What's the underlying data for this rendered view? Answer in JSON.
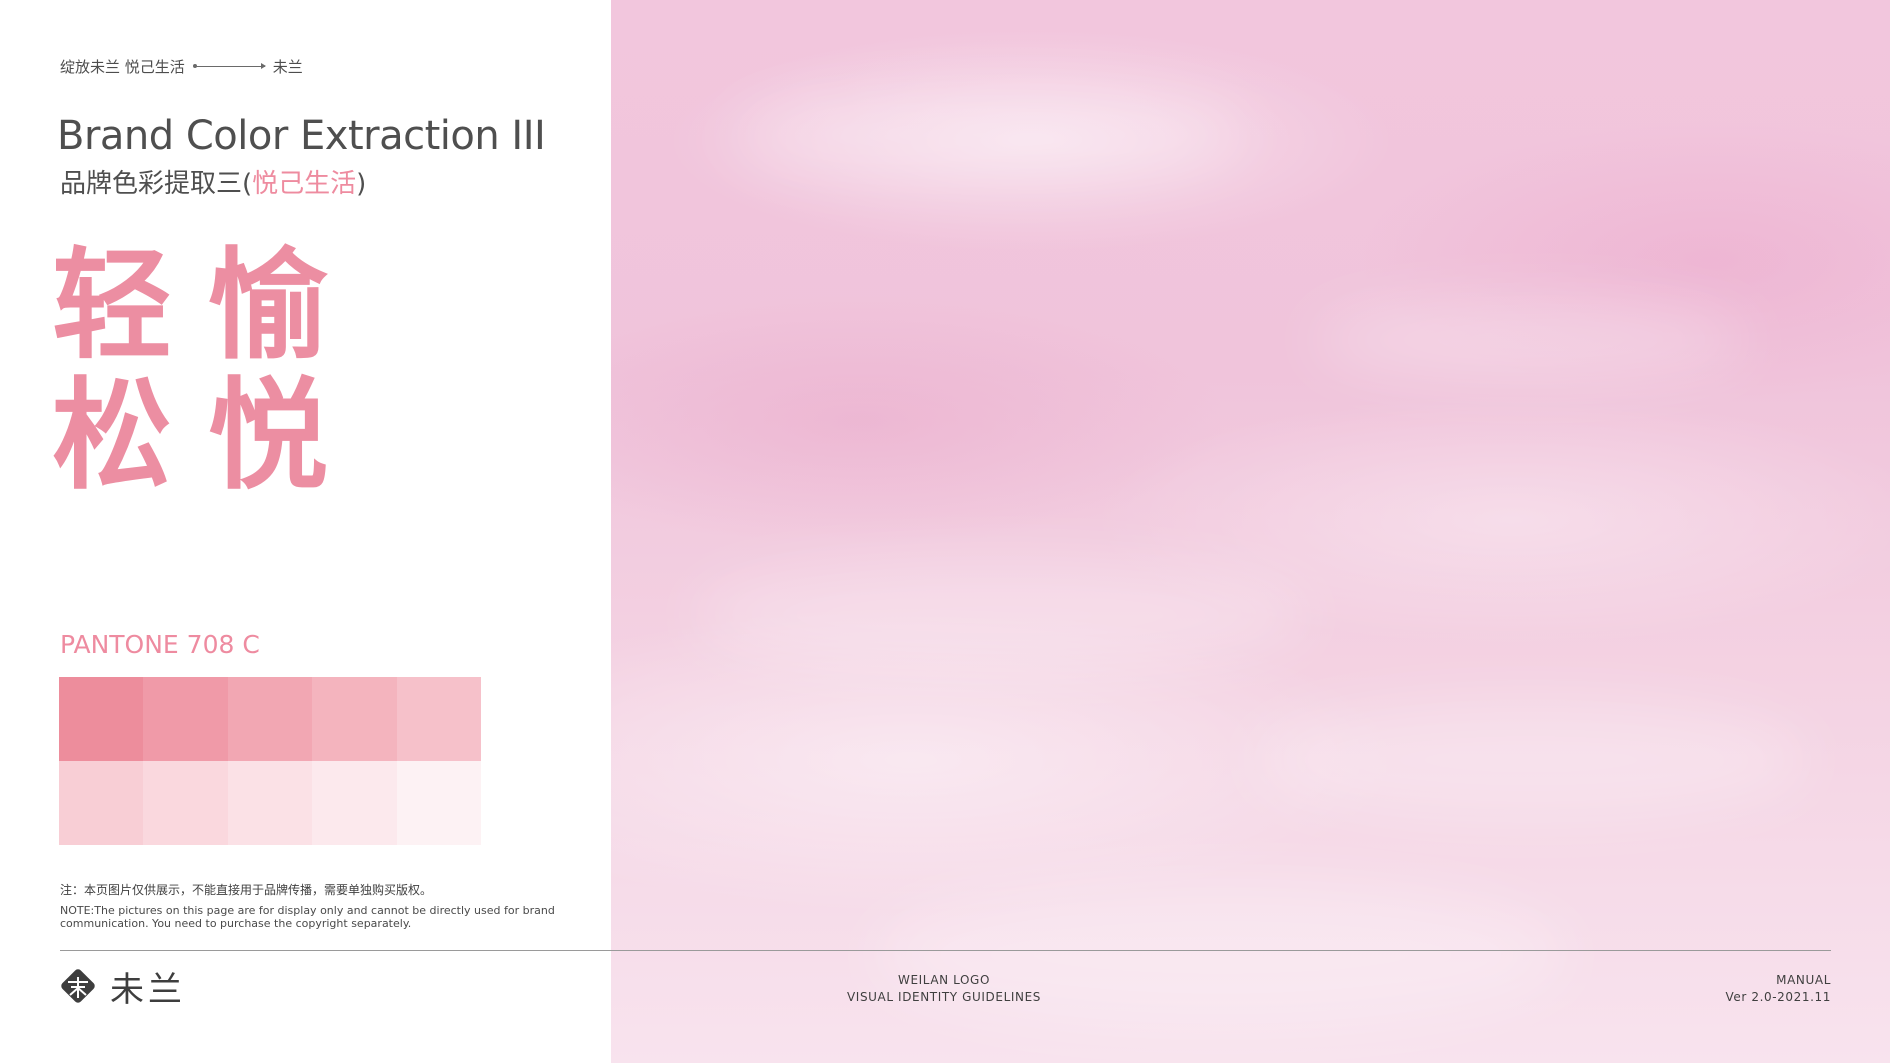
{
  "header": {
    "tagline": "绽放未兰 悦己生活",
    "brand_short": "未兰"
  },
  "title": {
    "en": "Brand Color Extraction III",
    "cn_prefix": "品牌色彩提取三(",
    "cn_accent": "悦己生活",
    "cn_suffix": ")"
  },
  "keywords": {
    "char1": "轻",
    "char2": "愉",
    "char3": "松",
    "char4": "悦"
  },
  "pantone": {
    "label": "PANTONE 708 C"
  },
  "swatches": {
    "row1": [
      "#ed8d9c",
      "#f09aa8",
      "#f2a7b3",
      "#f4b4be",
      "#f6c1ca"
    ],
    "row2": [
      "#f8ced5",
      "#fad8de",
      "#fbe1e6",
      "#fce9ed",
      "#fdf2f4"
    ]
  },
  "note": {
    "cn": "注：本页图片仅供展示，不能直接用于品牌传播，需要单独购买版权。",
    "en": "NOTE:The pictures on this page are for display only and cannot be directly used for brand communication. You need to purchase the copyright separately."
  },
  "footer": {
    "logo_text": "未兰",
    "center_line1": "WEILAN LOGO",
    "center_line2": "VISUAL IDENTITY GUIDELINES",
    "right_line1": "MANUAL",
    "right_line2": "Ver 2.0-2021.11"
  },
  "colors": {
    "accent_pink": "#ec8ea2",
    "text_gray": "#4f4f4f",
    "photo_base": "#f2c6dd"
  },
  "icons": {
    "logo": "weilan-logo-icon",
    "arrow": "double-arrow-icon"
  }
}
